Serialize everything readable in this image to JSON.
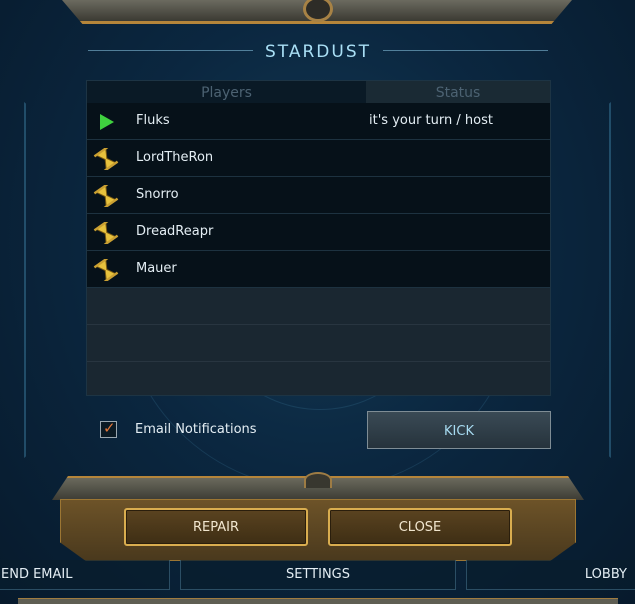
{
  "title": "STARDUST",
  "table": {
    "col_players": "Players",
    "col_status": "Status",
    "rows": [
      {
        "name": "Fluks",
        "status": "it's your turn / host",
        "icon": "play-icon"
      },
      {
        "name": "LordTheRon",
        "status": "",
        "icon": "hourglass-icon"
      },
      {
        "name": "Snorro",
        "status": "",
        "icon": "hourglass-icon"
      },
      {
        "name": "DreadReapr",
        "status": "",
        "icon": "hourglass-icon"
      },
      {
        "name": "Mauer",
        "status": "",
        "icon": "hourglass-icon"
      }
    ]
  },
  "email_notifications": {
    "label": "Email Notifications",
    "checked": true
  },
  "buttons": {
    "kick": "KICK",
    "repair": "REPAIR",
    "close": "CLOSE"
  },
  "nav": {
    "email": "END EMAIL",
    "settings": "SETTINGS",
    "lobby": "LOBBY"
  },
  "colors": {
    "accent_cyan": "#a9dff5",
    "gold": "#d9ad4f",
    "turn_green": "#3fd13f",
    "check_orange": "#e0763a"
  }
}
